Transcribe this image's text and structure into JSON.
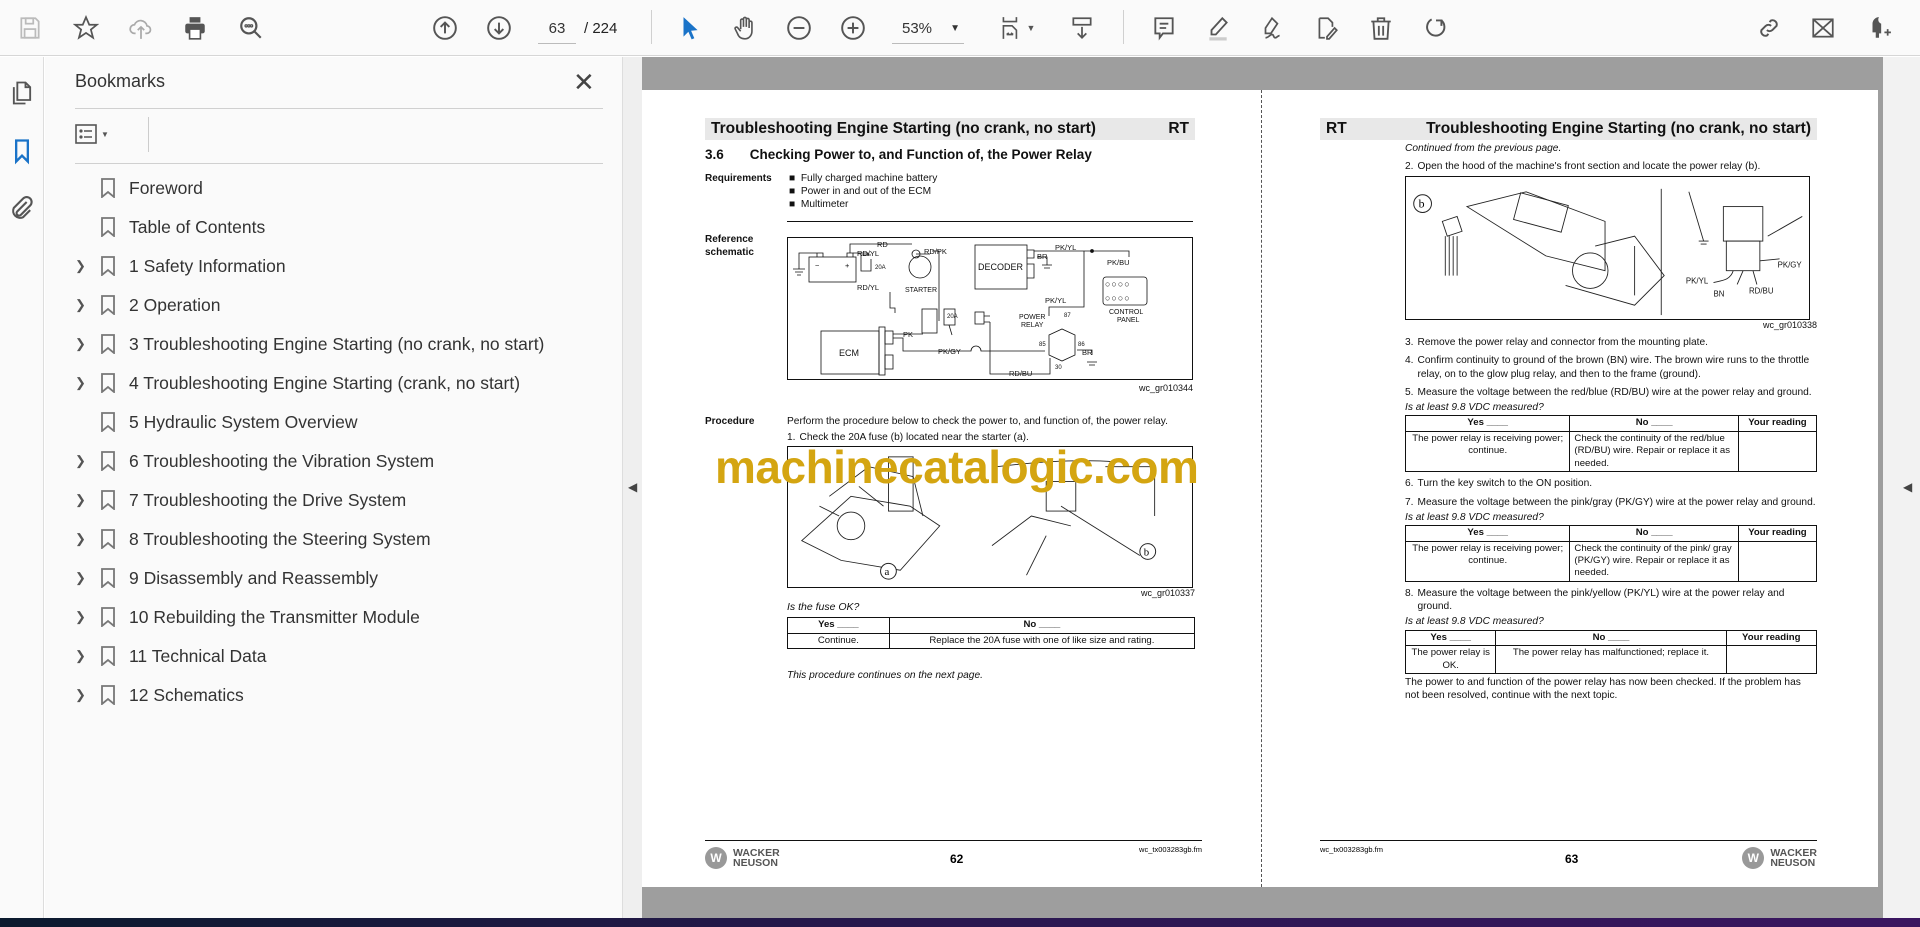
{
  "toolbar": {
    "page_current": "63",
    "page_total": "/ 224",
    "zoom": "53%"
  },
  "sidebar": {
    "title": "Bookmarks",
    "items": [
      {
        "label": "Foreword",
        "expandable": false
      },
      {
        "label": "Table of Contents",
        "expandable": false
      },
      {
        "label": "1 Safety Information",
        "expandable": true
      },
      {
        "label": "2 Operation",
        "expandable": true
      },
      {
        "label": "3 Troubleshooting Engine Starting (no crank, no start)",
        "expandable": true
      },
      {
        "label": "4 Troubleshooting Engine Starting (crank, no start)",
        "expandable": true
      },
      {
        "label": "5 Hydraulic System Overview",
        "expandable": false
      },
      {
        "label": "6 Troubleshooting the Vibration System",
        "expandable": true
      },
      {
        "label": "7 Troubleshooting the Drive System",
        "expandable": true
      },
      {
        "label": "8 Troubleshooting the Steering System",
        "expandable": true
      },
      {
        "label": "9 Disassembly and Reassembly",
        "expandable": true
      },
      {
        "label": "10 Rebuilding the Transmitter Module",
        "expandable": true
      },
      {
        "label": "11 Technical Data",
        "expandable": true
      },
      {
        "label": "12 Schematics",
        "expandable": true
      }
    ]
  },
  "watermark": "machinecatalogic.com",
  "left_page": {
    "header_title": "Troubleshooting Engine Starting (no crank, no start)",
    "header_code": "RT",
    "section_num": "3.6",
    "section_title": "Checking Power to, and Function of, the Power Relay",
    "req_label": "Requirements",
    "requirements": [
      "Fully charged machine battery",
      "Power in and out of the ECM",
      "Multimeter"
    ],
    "ref_label": "Reference schematic",
    "schematic": {
      "rd": "RD",
      "rdyl": "RD/YL",
      "rdyl2": "RD/YL",
      "rdpk": "RD/PK",
      "fuse1": "20A",
      "fuse2": "20A",
      "starter": "STARTER",
      "decoder": "DECODER",
      "br1": "BR",
      "br2": "BR",
      "pkyl1": "PK/YL",
      "pkyl2": "PK/YL",
      "pkbu": "PK/BU",
      "control": "CONTROL",
      "panel": "PANEL",
      "power": "POWER",
      "relay": "RELAY",
      "p87": "87",
      "p85": "85",
      "p86": "86",
      "p30": "30",
      "ecm": "ECM",
      "pk": "PK",
      "pkgy": "PK/GY",
      "rdbu": "RD/BU",
      "minus": "−",
      "plus": "+"
    },
    "schematic_id": "wc_gr010344",
    "proc_label": "Procedure",
    "proc_text": "Perform the procedure below to check the power to, and function of, the power relay.",
    "step1_num": "1.",
    "step1": "Check the 20A fuse (b) located near the starter (a).",
    "fig_a": "a",
    "fig_b": "b",
    "fig_id": "wc_gr010337",
    "question": "Is the fuse OK?",
    "table": {
      "yes": "Yes ____",
      "no": "No ____",
      "yes_text": "Continue.",
      "no_text": "Replace the 20A fuse with one of like size and rating."
    },
    "continues": "This procedure continues on the next page.",
    "footer_page": "62",
    "footer_file": "wc_tx003283gb.fm",
    "logo_line1": "WACKER",
    "logo_line2": "NEUSON"
  },
  "right_page": {
    "header_code": "RT",
    "header_title": "Troubleshooting Engine Starting (no crank, no start)",
    "continued": "Continued from the previous page.",
    "step2_num": "2.",
    "step2": "Open the hood of the machine's front section and locate the power relay (b).",
    "fig_b": "b",
    "wires": {
      "pkyl": "PK/YL",
      "bn": "BN",
      "rdbu": "RD/BU",
      "pkgy": "PK/GY"
    },
    "fig_id": "wc_gr010338",
    "step3_num": "3.",
    "step3": "Remove the power relay and connector from the mounting plate.",
    "step4_num": "4.",
    "step4": "Confirm continuity to ground of the brown (BN) wire. The brown wire runs to the throttle relay, on to the glow plug relay, and then to the frame (ground).",
    "step5_num": "5.",
    "step5": "Measure the voltage between the red/blue (RD/BU) wire at the power relay and ground.",
    "q1": "Is at least 9.8 VDC measured?",
    "t1": {
      "yes": "Yes ____",
      "no": "No ____",
      "reading": "Your reading",
      "yes_text": "The power relay is receiving power; continue.",
      "no_text": "Check the continuity of the red/blue (RD/BU) wire. Repair or replace it as needed."
    },
    "step6_num": "6.",
    "step6": "Turn the key switch to the ON position.",
    "step7_num": "7.",
    "step7": "Measure the voltage between the pink/gray (PK/GY) wire at the power relay and ground.",
    "q2": "Is at least 9.8 VDC measured?",
    "t2": {
      "yes": "Yes ____",
      "no": "No ____",
      "reading": "Your reading",
      "yes_text": "The power relay is receiving power; continue.",
      "no_text": "Check the continuity of the pink/ gray (PK/GY) wire. Repair or replace it as needed."
    },
    "step8_num": "8.",
    "step8": "Measure the voltage between the pink/yellow (PK/YL) wire at the power relay and ground.",
    "q3": "Is at least 9.8 VDC measured?",
    "t3": {
      "yes": "Yes ____",
      "no": "No ____",
      "reading": "Your reading",
      "yes_text": "The power relay is OK.",
      "no_text": "The power relay has malfunctioned; replace it."
    },
    "closing": "The power to and function of the power relay has now been checked. If the problem has not been resolved, continue with the next topic.",
    "footer_page": "63",
    "footer_file": "wc_tx003283gb.fm",
    "logo_line1": "WACKER",
    "logo_line2": "NEUSON"
  }
}
